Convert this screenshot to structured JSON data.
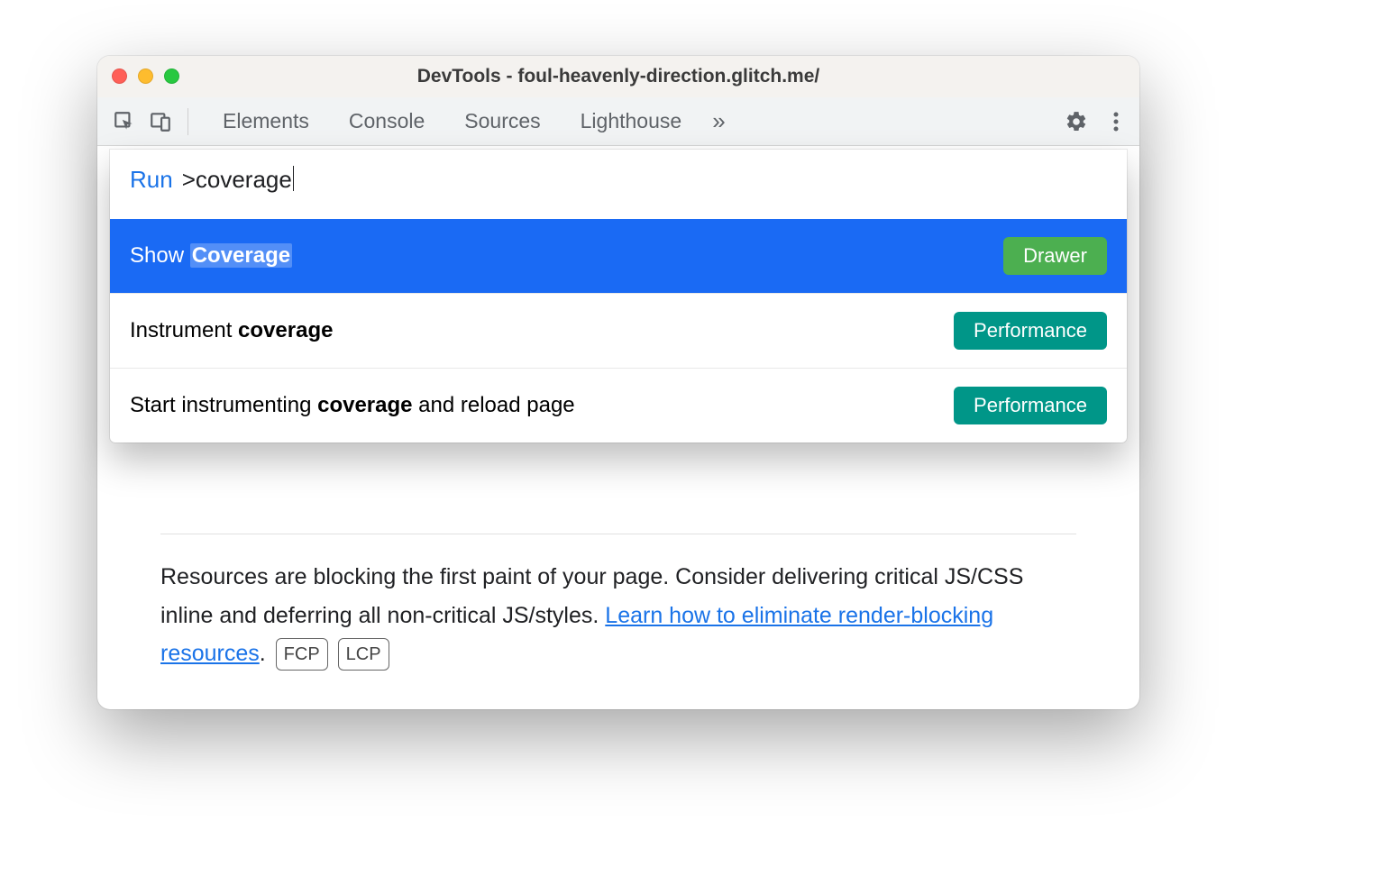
{
  "window": {
    "title": "DevTools - foul-heavenly-direction.glitch.me/"
  },
  "toolbar": {
    "tabs": [
      "Elements",
      "Console",
      "Sources",
      "Lighthouse"
    ],
    "more_glyph": "»"
  },
  "command_menu": {
    "prompt_label": "Run",
    "query": ">coverage",
    "items": [
      {
        "prefix": "Show ",
        "match": "Coverage",
        "suffix": "",
        "badge": "Drawer",
        "badge_class": "drawer",
        "selected": true
      },
      {
        "prefix": "Instrument ",
        "match": "coverage",
        "suffix": "",
        "badge": "Performance",
        "badge_class": "perf",
        "selected": false
      },
      {
        "prefix": "Start instrumenting ",
        "match": "coverage",
        "suffix": " and reload page",
        "badge": "Performance",
        "badge_class": "perf",
        "selected": false
      }
    ]
  },
  "body": {
    "text_before_link": "Resources are blocking the first paint of your page. Consider delivering critical JS/CSS inline and deferring all non-critical JS/styles. ",
    "link_text": "Learn how to eliminate render-blocking resources",
    "period": ".",
    "metric1": "FCP",
    "metric2": "LCP"
  }
}
